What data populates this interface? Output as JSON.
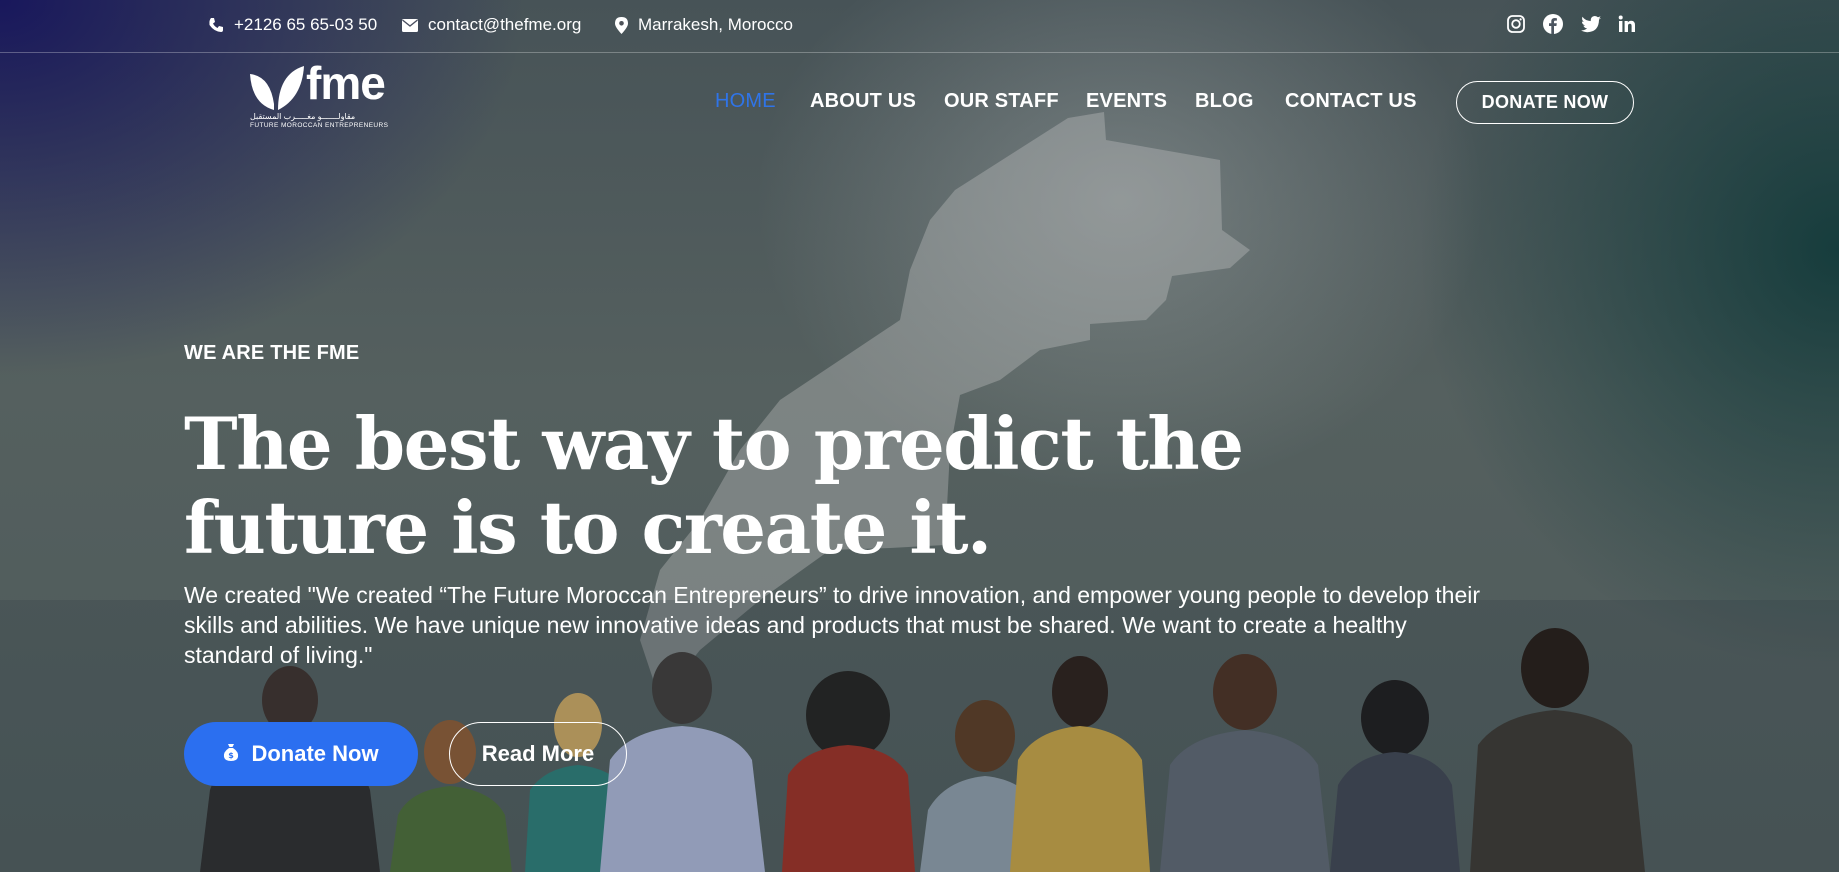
{
  "topbar": {
    "phone": "+2126 65 65-03 50",
    "email": "contact@thefme.org",
    "location": "Marrakesh, Morocco",
    "social_icons": [
      "instagram-icon",
      "facebook-icon",
      "twitter-icon",
      "linkedin-icon"
    ]
  },
  "logo": {
    "name": "fme",
    "tagline": "FUTURE MOROCCAN ENTREPRENEURS",
    "arabic": "مقاولـــــــو مغـــــرب المستقبل"
  },
  "nav": {
    "items": [
      {
        "label": "HOME",
        "active": true
      },
      {
        "label": "ABOUT US",
        "active": false
      },
      {
        "label": "OUR STAFF",
        "active": false
      },
      {
        "label": "EVENTS",
        "active": false
      },
      {
        "label": "BLOG",
        "active": false
      },
      {
        "label": "CONTACT US",
        "active": false
      }
    ],
    "donate_label": "DONATE NOW"
  },
  "hero": {
    "eyebrow": "WE ARE THE FME",
    "headline": "The best way to predict the future is to create it.",
    "description": "We created \"We created “The Future Moroccan Entrepreneurs” to drive innovation, and empower young people to develop their skills and abilities. We have unique new innovative ideas and products that must be shared. We want to create a healthy standard of living.\"",
    "primary_button": "Donate Now",
    "primary_button_icon": "money-bag-icon",
    "secondary_button": "Read More"
  },
  "colors": {
    "accent": "#2b6ff0",
    "nav_active": "#2f74e8",
    "text": "#ffffff"
  }
}
